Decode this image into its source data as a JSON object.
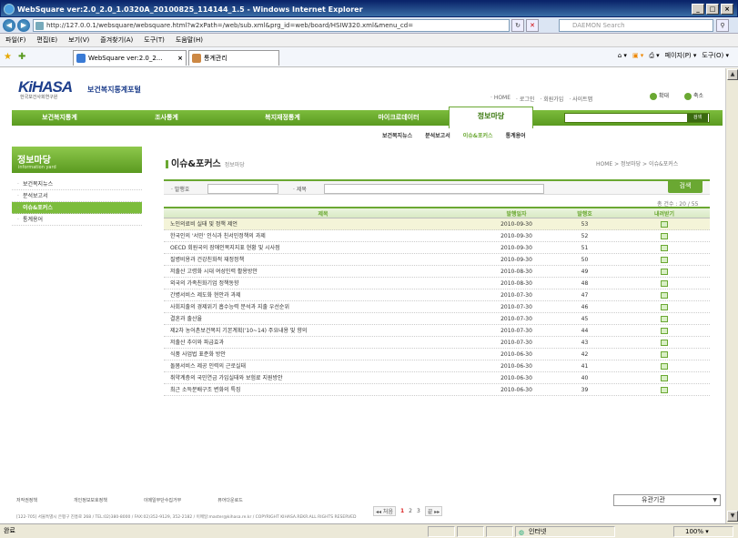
{
  "window": {
    "title": "WebSquare ver:2.0_2.0_1.0320A_20100825_114144_1.5 - Windows Internet Explorer",
    "min": "_",
    "max": "□",
    "close": "×"
  },
  "browser": {
    "url": "http://127.0.0.1/websquare/websquare.html?w2xPath=/web/sub.xml&prg_id=web/board/HSIW320.xml&menu_cd=",
    "search_placeholder": "DAEMON Search",
    "menu": [
      "파일(F)",
      "편집(E)",
      "보기(V)",
      "즐겨찾기(A)",
      "도구(T)",
      "도움말(H)"
    ],
    "tabs": [
      "WebSquare ver:2.0_2...",
      "통계관리"
    ],
    "commands": [
      "페이지(P) ▾",
      "도구(O) ▾"
    ]
  },
  "site": {
    "logo": "KiHASA",
    "logo_sub": "한국보건사회연구원",
    "name": "보건복지통계포털",
    "util_links": [
      "· HOME",
      "· 로그인",
      "· 회원가입",
      "· 사이트맵"
    ],
    "util_buttons": [
      "확대",
      "축소"
    ],
    "gnb": [
      "보건복지통계",
      "조사통계",
      "복지재정통계",
      "마이크로데이터"
    ],
    "gnb_active": "정보마당",
    "gsearch_btn": "검색",
    "subnav": [
      "보건복지뉴스",
      "분석보고서",
      "이슈&포커스",
      "통계용어"
    ]
  },
  "lnb": {
    "title": "정보마당",
    "subtitle": "information yard",
    "items": [
      "보건복지뉴스",
      "분석보고서",
      "이슈&포커스",
      "통계용어"
    ]
  },
  "page": {
    "title": "이슈&포커스",
    "crumb": "정보마당",
    "location": "HOME > 정보마당 > 이슈&포커스"
  },
  "filter": {
    "label1": "· 발행호",
    "label2": "· 제목",
    "btn": "검색"
  },
  "count": "총 건수 : 20 / 55",
  "table": {
    "headers": [
      "제목",
      "발행일자",
      "발행호",
      "내려받기"
    ],
    "rows": [
      {
        "title": "노인의료비 실태 및 정책 제언",
        "date": "2010-09-30",
        "no": "53"
      },
      {
        "title": "한국인의 '서민' 인식과 친서민정책의 과제",
        "date": "2010-09-30",
        "no": "52"
      },
      {
        "title": "OECD 회원국의 장애인복지지표 현황 및 시사점",
        "date": "2010-09-30",
        "no": "51"
      },
      {
        "title": "질병비용과 건강친화적 재정정책",
        "date": "2010-09-30",
        "no": "50"
      },
      {
        "title": "저출산 고령화 시대 여성인력 활용방안",
        "date": "2010-08-30",
        "no": "49"
      },
      {
        "title": "외국의 가족친화기업 정책동향",
        "date": "2010-08-30",
        "no": "48"
      },
      {
        "title": "간병서비스 제도화 현안과 과제",
        "date": "2010-07-30",
        "no": "47"
      },
      {
        "title": "사회지출의 경제위기 흡수능력 분석과 지출 우선순위",
        "date": "2010-07-30",
        "no": "46"
      },
      {
        "title": "결혼과 출산율",
        "date": "2010-07-30",
        "no": "45"
      },
      {
        "title": "제2차 농어촌보건복지 기본계획('10~14) 주요내용 및 향의",
        "date": "2010-07-30",
        "no": "44"
      },
      {
        "title": "저출산 추이와 파급효과",
        "date": "2010-07-30",
        "no": "43"
      },
      {
        "title": "식품 사업법 표준화 방안",
        "date": "2010-06-30",
        "no": "42"
      },
      {
        "title": "돌봄서비스 제공 인력의 근로실태",
        "date": "2010-06-30",
        "no": "41"
      },
      {
        "title": "취약계층의 국민연금 가입실태와 보험료 지원방안",
        "date": "2010-06-30",
        "no": "40"
      },
      {
        "title": "최근 소득분배구조 변화의 특징",
        "date": "2010-06-30",
        "no": "39"
      }
    ],
    "dl_icon": "hwp"
  },
  "paging": {
    "first": "◂◂ 처음",
    "pages": [
      "1",
      "2",
      "3"
    ],
    "last": "끝 ▸▸"
  },
  "footer": {
    "links": [
      "저작권정책",
      "개인정보보호정책",
      "이메일무단수집거부",
      "뷰어다운로드"
    ],
    "select": "유관기관",
    "address": "[122-705] 서울특별시 은평구 진흥로 268  /  TEL:02)380-8000  /  FAX:02)352-9129, 352-2182  /  이메일:master@kihasa.re.kr  /  COPYRIGHT KIHASA.REKR.ALL RIGHTS RESERVED"
  },
  "status": {
    "left": "완료",
    "zone": "인터넷",
    "zoom": "100%"
  }
}
